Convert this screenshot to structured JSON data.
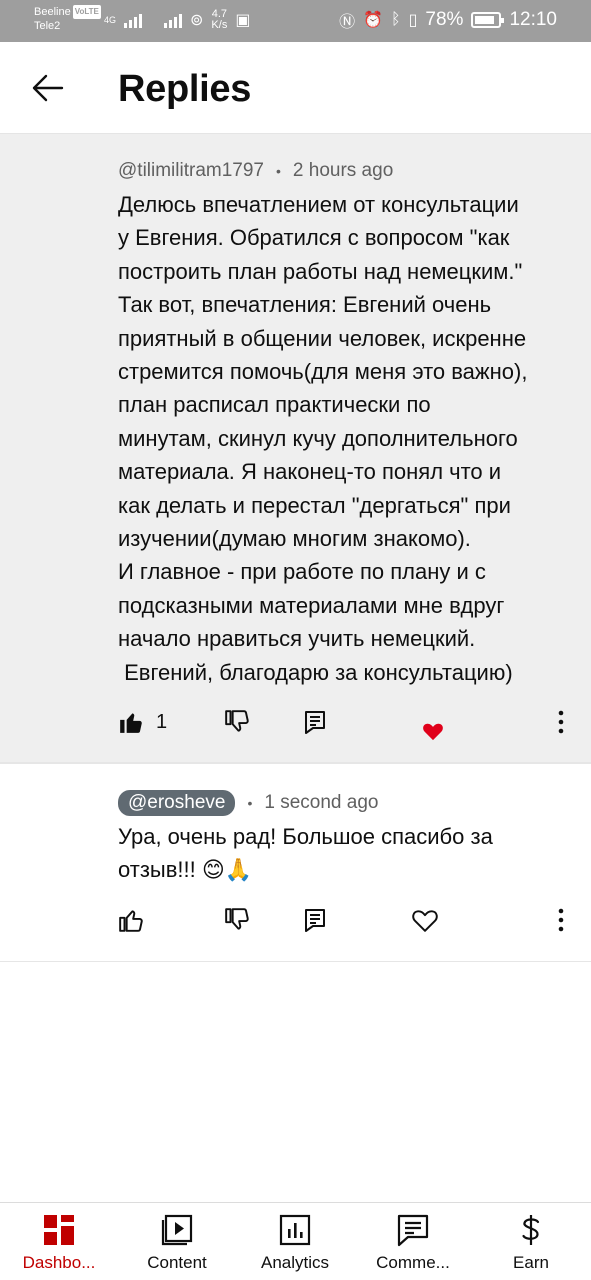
{
  "status_bar": {
    "carrier_1": "Beeline",
    "carrier_1_badge": "VoLTE",
    "carrier_2": "Tele2",
    "network_type": "4G",
    "speed_value": "4.7",
    "speed_unit": "K/s",
    "battery": "78%",
    "time": "12:10"
  },
  "app_bar": {
    "title": "Replies",
    "back_icon": "arrow-left-icon"
  },
  "parent_comment": {
    "author": "@tilimilitram1797",
    "separator": "•",
    "time": "2 hours ago",
    "lines": [
      "Делюсь впечатлением от консультации",
      "у Евгения. Обратился с вопросом \"как",
      "построить план работы над немецким.\"",
      "Так вот, впечатления: Евгений очень",
      "приятный в общении человек, искренне",
      "стремится помочь(для меня это важно),",
      "план расписал практически по",
      "минутам, скинул кучу дополнительного",
      "материала. Я наконец-то понял что и",
      "как делать и перестал \"дергаться\" при",
      "изучении(думаю многим знакомо).",
      "И главное - при работе по плану и с",
      "подсказными материалами мне вдруг",
      "начало нравиться учить немецкий.",
      " Евгений, благодарю за консультацию)"
    ],
    "like_count": "1",
    "liked": true,
    "hearted": true,
    "heart_color": "#e0001a"
  },
  "reply_comment": {
    "author": "@erosheve",
    "separator": "•",
    "time": "1 second ago",
    "lines": [
      "Ура, очень рад! Большое спасибо за",
      "отзыв!!! 😊🙏"
    ],
    "liked": false,
    "hearted": false
  },
  "bottom_nav": {
    "active_color": "#c00000",
    "items": [
      {
        "label": "Dashbo...",
        "icon": "dashboard-icon",
        "active": true
      },
      {
        "label": "Content",
        "icon": "content-icon",
        "active": false
      },
      {
        "label": "Analytics",
        "icon": "analytics-icon",
        "active": false
      },
      {
        "label": "Comme...",
        "icon": "comments-icon",
        "active": false
      },
      {
        "label": "Earn",
        "icon": "dollar-icon",
        "active": false
      }
    ]
  }
}
